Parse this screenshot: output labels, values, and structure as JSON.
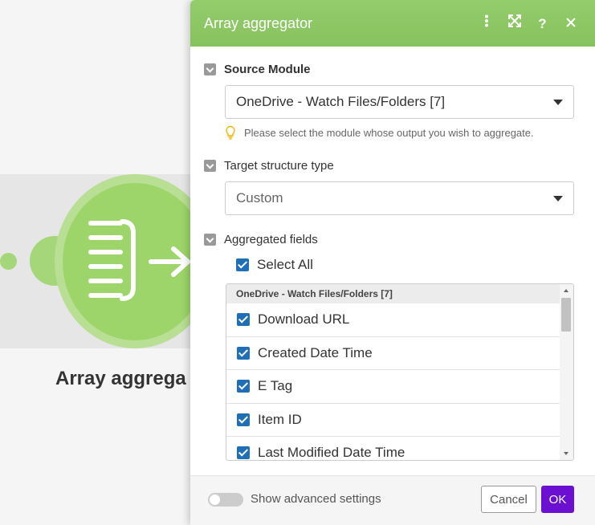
{
  "module": {
    "label": "Array aggrega"
  },
  "panel": {
    "title": "Array aggregator",
    "header_icons": [
      "more-vert-icon",
      "expand-icon",
      "help-icon",
      "close-icon"
    ],
    "source_module": {
      "label": "Source Module",
      "value": "OneDrive - Watch Files/Folders [7]",
      "hint": "Please select the module whose output you wish to aggregate."
    },
    "target_structure": {
      "label": "Target structure type",
      "value": "Custom"
    },
    "aggregated_fields": {
      "label": "Aggregated fields",
      "select_all_label": "Select All",
      "group_header": "OneDrive - Watch Files/Folders [7]",
      "items": [
        {
          "label": "Download URL",
          "checked": true
        },
        {
          "label": "Created Date Time",
          "checked": true
        },
        {
          "label": "E Tag",
          "checked": true
        },
        {
          "label": "Item ID",
          "checked": true
        },
        {
          "label": "Last Modified Date Time",
          "checked": true
        }
      ]
    },
    "footer": {
      "advanced_label": "Show advanced settings",
      "advanced_enabled": false,
      "cancel_label": "Cancel",
      "ok_label": "OK"
    }
  },
  "colors": {
    "header_green": "#8dc866",
    "module_green": "#9dd56a",
    "checkbox_blue": "#1e6fb8",
    "ok_purple": "#6b10d1"
  }
}
